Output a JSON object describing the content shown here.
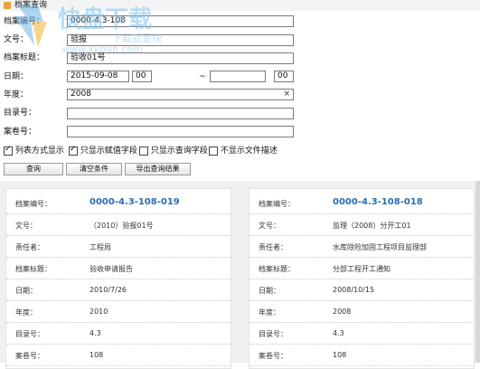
{
  "window": {
    "title": "档案查询"
  },
  "form": {
    "archive_no": {
      "label": "档案编号：",
      "value": "0000-4.3-108"
    },
    "doc_no": {
      "label": "文号：",
      "value": "验报"
    },
    "archive_title": {
      "label": "档案标题：",
      "value": "验收01号"
    },
    "date": {
      "label": "日期：",
      "from_date": "2015-09-08",
      "from_hour": "00",
      "sep": "~",
      "to_date": "",
      "to_hour": "00"
    },
    "year": {
      "label": "年度：",
      "value": "2008",
      "clear_icon": "×"
    },
    "catalog_no": {
      "label": "目录号：",
      "value": ""
    },
    "volume_no": {
      "label": "案卷号：",
      "value": ""
    }
  },
  "options": [
    {
      "label": "列表方式显示",
      "checked": true
    },
    {
      "label": "只显示赋值字段",
      "checked": true
    },
    {
      "label": "只显示查询字段",
      "checked": false
    },
    {
      "label": "不显示文件描述",
      "checked": false
    }
  ],
  "buttons": {
    "query": "查询",
    "clear": "清空条件",
    "export": "导出查询结果"
  },
  "watermark": {
    "brand": "快盘下载",
    "slogan": "下载就是快",
    "url": "www.kkpan.com"
  },
  "results": [
    {
      "rows": [
        {
          "key": "档案编号：",
          "value": "0000-4.3-108-019"
        },
        {
          "key": "文号：",
          "value": "（2010）验报01号"
        },
        {
          "key": "责任者：",
          "value": "工程局"
        },
        {
          "key": "档案标题：",
          "value": "验收申请报告"
        },
        {
          "key": "日期：",
          "value": "2010/7/26"
        },
        {
          "key": "年度：",
          "value": "2010"
        },
        {
          "key": "目录号：",
          "value": "4.3"
        },
        {
          "key": "案卷号：",
          "value": "108"
        }
      ]
    },
    {
      "rows": [
        {
          "key": "档案编号：",
          "value": "0000-4.3-108-018"
        },
        {
          "key": "文号：",
          "value": "监理（2008）分开工01"
        },
        {
          "key": "责任者：",
          "value": "水库除险加固工程项目监理部"
        },
        {
          "key": "档案标题：",
          "value": "分部工程开工通知"
        },
        {
          "key": "日期：",
          "value": "2008/10/15"
        },
        {
          "key": "年度：",
          "value": "2008"
        },
        {
          "key": "目录号：",
          "value": "4.3"
        },
        {
          "key": "案卷号：",
          "value": "108"
        }
      ]
    }
  ]
}
